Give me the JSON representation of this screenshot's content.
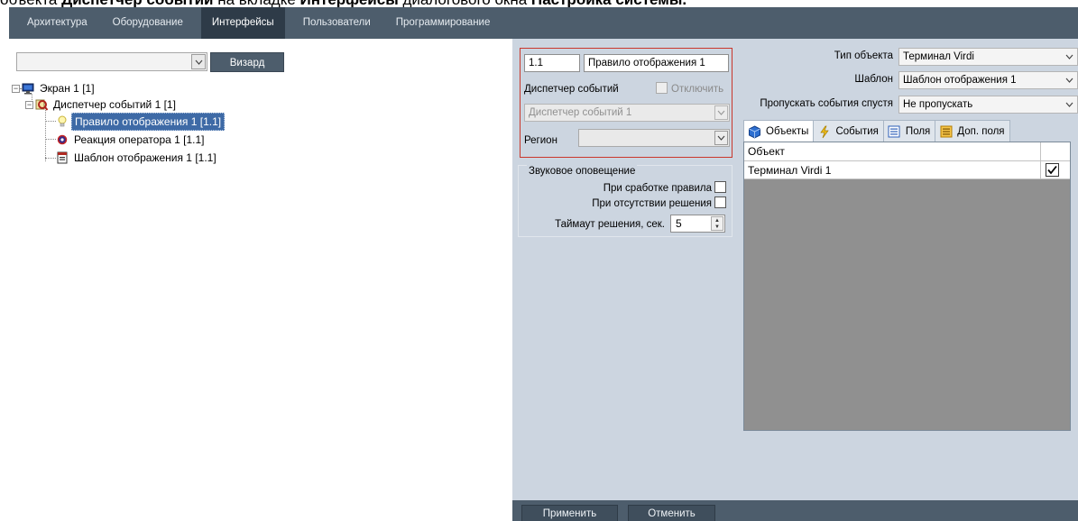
{
  "caption": {
    "part1": "объекта ",
    "bold1": "Диспетчер событий",
    "part2": " на вкладке ",
    "bold2": "Интерфейсы",
    "part3": " диалогового окна ",
    "bold3": "Настройка системы."
  },
  "top_tabs": [
    {
      "label": "Архитектура"
    },
    {
      "label": "Оборудование"
    },
    {
      "label": "Интерфейсы",
      "active": true
    },
    {
      "label": "Пользователи"
    },
    {
      "label": "Программирование"
    }
  ],
  "left": {
    "object_combo_value": "",
    "wizard_label": "Визард"
  },
  "tree": {
    "items": [
      {
        "label": "Экран 1 [1]"
      },
      {
        "label": "Диспетчер событий 1 [1]"
      },
      {
        "label": "Правило отображения 1 [1.1]",
        "selected": true
      },
      {
        "label": "Реакция оператора 1 [1.1]"
      },
      {
        "label": "Шаблон отображения 1 [1.1]"
      }
    ]
  },
  "settings": {
    "id_value": "1.1",
    "name_value": "Правило отображения 1",
    "dispatcher_label": "Диспетчер событий",
    "disable_label": "Отключить",
    "dispatcher_value": "Диспетчер событий 1",
    "region_label": "Регион",
    "region_value": "",
    "sound_group_title": "Звуковое оповещение",
    "on_rule_label": "При сработке правила",
    "on_no_decision_label": "При отсутствии решения",
    "timeout_label": "Таймаут решения, сек.",
    "timeout_value": "5"
  },
  "right": {
    "object_type_label": "Тип объекта",
    "object_type_value": "Терминал Virdi",
    "template_label": "Шаблон",
    "template_value": "Шаблон отображения 1",
    "skip_label": "Пропускать события спустя",
    "skip_value": "Не пропускать",
    "tabs": [
      {
        "label": "Объекты",
        "icon": "cube-icon",
        "active": true
      },
      {
        "label": "События",
        "icon": "lightning-icon"
      },
      {
        "label": "Поля",
        "icon": "list-icon"
      },
      {
        "label": "Доп. поля",
        "icon": "list-orange-icon"
      }
    ],
    "grid": {
      "header": "Объект",
      "rows": [
        {
          "object": "Терминал Virdi 1",
          "checked": true
        }
      ]
    }
  },
  "buttons": {
    "apply": "Применить",
    "cancel": "Отменить"
  },
  "colors": {
    "topbar": "#4d5d6c",
    "active_tab": "#2e3b48",
    "panel": "#ccd5e0",
    "selection": "#3e6aa6",
    "highlight_border": "#c9372c"
  }
}
